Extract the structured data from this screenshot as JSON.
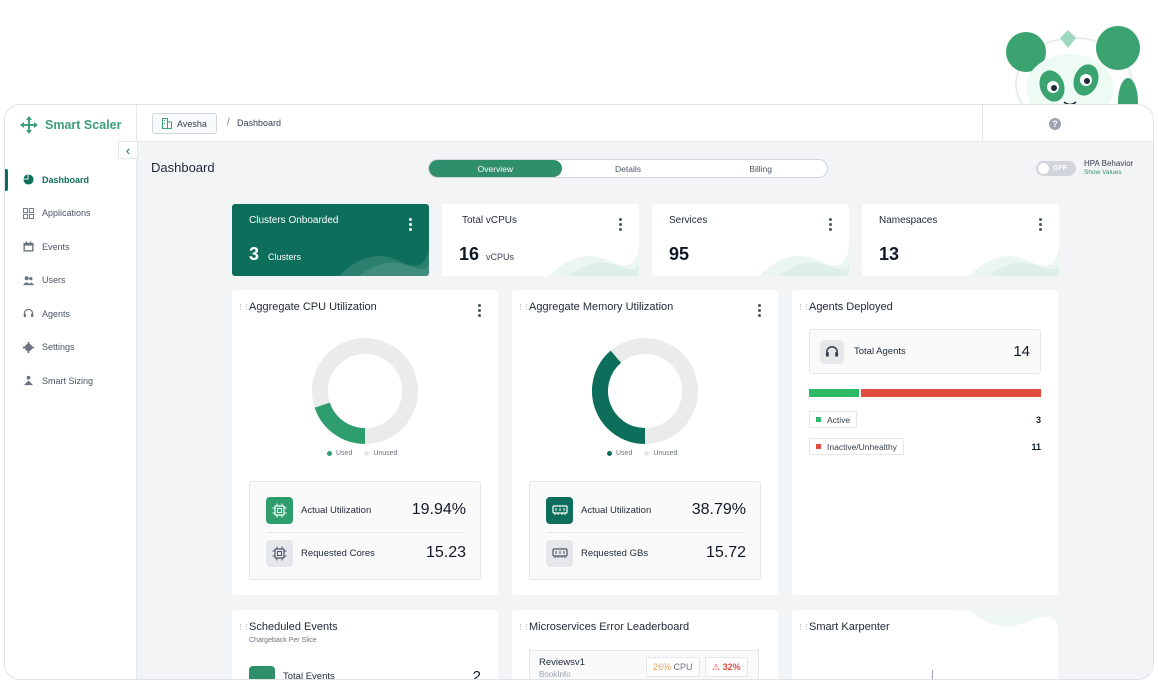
{
  "app": {
    "name": "Smart Scaler"
  },
  "sidebar": {
    "items": [
      {
        "label": "Dashboard",
        "icon": "pie-chart-icon",
        "active": true
      },
      {
        "label": "Applications",
        "icon": "grid-icon"
      },
      {
        "label": "Events",
        "icon": "calendar-icon"
      },
      {
        "label": "Users",
        "icon": "users-icon"
      },
      {
        "label": "Agents",
        "icon": "headset-icon"
      },
      {
        "label": "Settings",
        "icon": "gear-icon"
      },
      {
        "label": "Smart Sizing",
        "icon": "sizing-icon"
      }
    ]
  },
  "topbar": {
    "org": "Avesha",
    "separator": "/",
    "breadcrumb": "Dashboard"
  },
  "page": {
    "title": "Dashboard"
  },
  "tabs": [
    {
      "label": "Overview",
      "active": true
    },
    {
      "label": "Details"
    },
    {
      "label": "Billing"
    }
  ],
  "hpa": {
    "toggle": "OFF",
    "label": "HPA Behavior",
    "link": "Show Values"
  },
  "stats": {
    "clusters": {
      "title": "Clusters Onboarded",
      "value": "3",
      "unit": "Clusters"
    },
    "vcpus": {
      "title": "Total vCPUs",
      "value": "16",
      "unit": "vCPUs"
    },
    "services": {
      "title": "Services",
      "value": "95"
    },
    "namespaces": {
      "title": "Namespaces",
      "value": "13"
    }
  },
  "cpu": {
    "title": "Aggregate CPU Utilization",
    "legend_used": "Used",
    "legend_unused": "Unused",
    "used_fraction": 0.1994,
    "actual_label": "Actual Utilization",
    "actual_value": "19.94%",
    "requested_label": "Requested Cores",
    "requested_value": "15.23"
  },
  "memory": {
    "title": "Aggregate Memory Utilization",
    "legend_used": "Used",
    "legend_unused": "Unused",
    "used_fraction": 0.3879,
    "actual_label": "Actual Utilization",
    "actual_value": "38.79%",
    "requested_label": "Requested GBs",
    "requested_value": "15.72"
  },
  "agents": {
    "title": "Agents Deployed",
    "total_label": "Total Agents",
    "total_value": "14",
    "active_label": "Active",
    "active_count": "3",
    "inactive_label": "Inactive/Unhealthy",
    "inactive_count": "11",
    "active_fraction": 0.2143
  },
  "scheduled": {
    "title": "Scheduled Events",
    "subtitle": "Chargeback Per Slice",
    "total_label": "Total Events",
    "total_value": "2"
  },
  "leaderboard": {
    "title": "Microservices Error Leaderboard",
    "row_name": "Reviewsv1",
    "row_sub": "BookInfo",
    "cpu_pct": "26%",
    "cpu_label": "CPU",
    "error_pct": "32%"
  },
  "karpenter": {
    "title": "Smart Karpenter"
  },
  "colors": {
    "brand": "#0e6e5c",
    "accent": "#2f8f6a",
    "light_green": "#3aa36f",
    "active": "#2fb866",
    "inactive": "#e24c3f",
    "warning": "#e8a05c"
  }
}
